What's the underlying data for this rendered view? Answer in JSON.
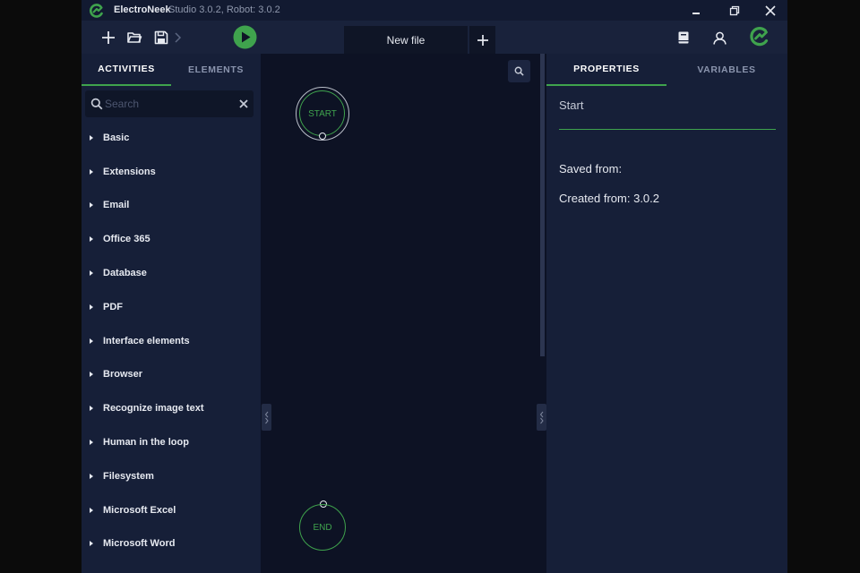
{
  "titlebar": {
    "app_name": "ElectroNeek",
    "version": "Studio 3.0.2, Robot: 3.0.2",
    "icons": [
      "electroneek-logo-icon",
      "minimize-icon",
      "restore-icon",
      "close-icon"
    ]
  },
  "toolbar": {
    "icons": [
      "plus-icon",
      "open-folder-icon",
      "save-icon",
      "chevron-right-icon",
      "run-play-icon",
      "book-icon",
      "user-icon",
      "electroneek-badge-icon"
    ],
    "accent": "#3fa34d"
  },
  "tabs": {
    "file_tab_label": "New file",
    "add_tab_icon": "plus-icon"
  },
  "left_panel": {
    "tabs": [
      "ACTIVITIES",
      "ELEMENTS"
    ],
    "active_tab": "ACTIVITIES",
    "search": {
      "placeholder": "Search",
      "value": ""
    },
    "categories": [
      "Basic",
      "Extensions",
      "Email",
      "Office 365",
      "Database",
      "PDF",
      "Interface elements",
      "Browser",
      "Recognize image text",
      "Human in the loop",
      "Filesystem",
      "Microsoft Excel",
      "Microsoft Word"
    ]
  },
  "canvas": {
    "start_node": "START",
    "end_node": "END"
  },
  "right_panel": {
    "tabs": [
      "PROPERTIES",
      "VARIABLES"
    ],
    "active_tab": "PROPERTIES",
    "name_value": "Start",
    "saved_from": "Saved from:",
    "created_from": "Created from: 3.0.2"
  },
  "colors": {
    "accent_green": "#3fa34d",
    "panel_bg": "#161f38",
    "canvas_bg": "#0d1224"
  }
}
